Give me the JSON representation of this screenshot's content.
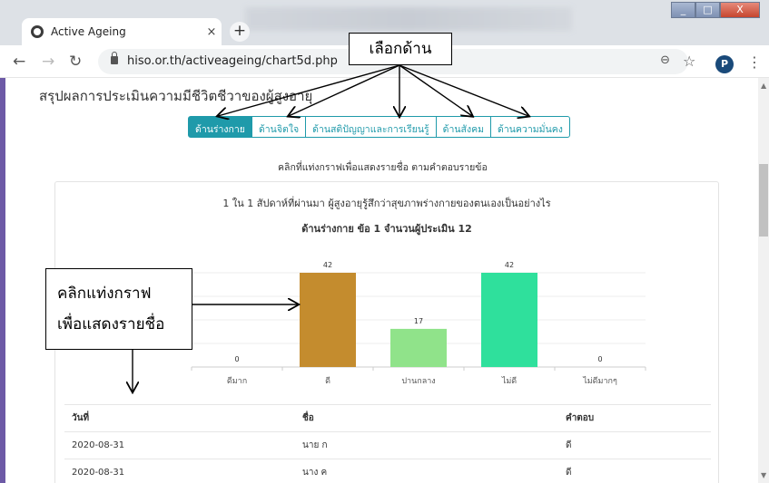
{
  "browser": {
    "tab_title": "Active Ageing",
    "tab_close": "×",
    "new_tab": "+",
    "url": "hiso.or.th/activeageing/chart5d.php",
    "profile_initial": "P",
    "window_controls": [
      "_",
      "□",
      "X"
    ]
  },
  "page": {
    "title": "สรุปผลการประเมินความมีชีวิตชีวาของผู้สูงอายุ",
    "tabs": [
      {
        "label": "ด้านร่างกาย",
        "active": true
      },
      {
        "label": "ด้านจิตใจ",
        "active": false
      },
      {
        "label": "ด้านสติปัญญาและการเรียนรู้",
        "active": false
      },
      {
        "label": "ด้านสังคม",
        "active": false
      },
      {
        "label": "ด้านความมั่นคง",
        "active": false
      }
    ],
    "hint": "คลิกที่แท่งกราฟเพื่อแสดงรายชื่อ ตามคำตอบรายข้อ",
    "question": "1 ใน 1 สัปดาห์ที่ผ่านมา ผู้สูงอายุรู้สึกว่าสุขภาพร่างกายของตนเองเป็นอย่างไร",
    "question_sub": "ด้านร่างกาย ข้อ 1 จำนวนผู้ประเมิน 12"
  },
  "chart_data": {
    "type": "bar",
    "categories": [
      "ดีมาก",
      "ดี",
      "ปานกลาง",
      "ไม่ดี",
      "ไม่ดีมากๆ"
    ],
    "values": [
      0,
      42,
      17,
      42,
      0
    ],
    "data_labels": [
      "0",
      "42",
      "17",
      "42",
      "0"
    ],
    "colors": [
      "#c0c0c0",
      "#c48c2e",
      "#90e38a",
      "#2fe09c",
      "#c0c0c0"
    ],
    "ylim": [
      0,
      42
    ],
    "grid": true
  },
  "table": {
    "headers": [
      "วันที่",
      "ชื่อ",
      "คำตอบ"
    ],
    "rows": [
      [
        "2020-08-31",
        "นาย ก",
        "ดี"
      ],
      [
        "2020-08-31",
        "นาง ค",
        "ดี"
      ]
    ]
  },
  "annotations": {
    "top": "เลือกด้าน",
    "left_line1": "คลิกแท่งกราฟ",
    "left_line2": "เพื่อแสดงรายชื่อ"
  }
}
